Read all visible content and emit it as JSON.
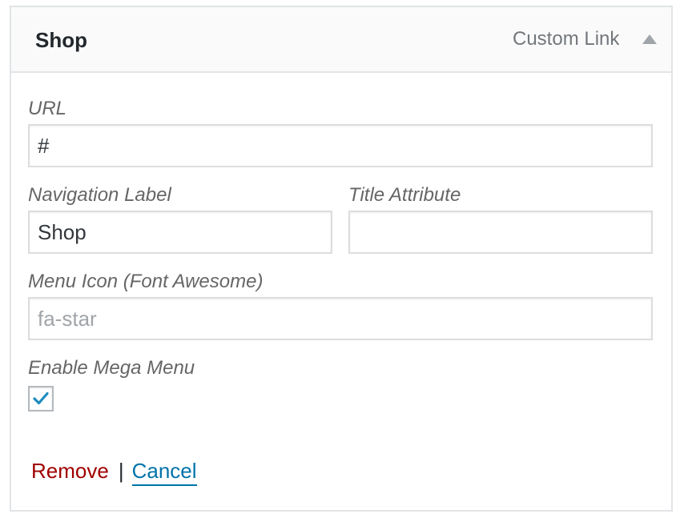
{
  "header": {
    "title": "Shop",
    "item_type": "Custom Link",
    "toggle_icon": "arrow-up-icon"
  },
  "fields": {
    "url": {
      "label": "URL",
      "value": "#"
    },
    "navigation_label": {
      "label": "Navigation Label",
      "value": "Shop"
    },
    "title_attribute": {
      "label": "Title Attribute",
      "value": ""
    },
    "menu_icon": {
      "label": "Menu Icon (Font Awesome)",
      "value": "",
      "placeholder": "fa-star"
    },
    "mega_menu": {
      "label": "Enable Mega Menu",
      "checked": true
    }
  },
  "actions": {
    "remove_label": "Remove",
    "separator": "|",
    "cancel_label": "Cancel"
  },
  "colors": {
    "checkmark": "#1e8cbe",
    "remove": "#a00000",
    "cancel": "#0073aa"
  }
}
